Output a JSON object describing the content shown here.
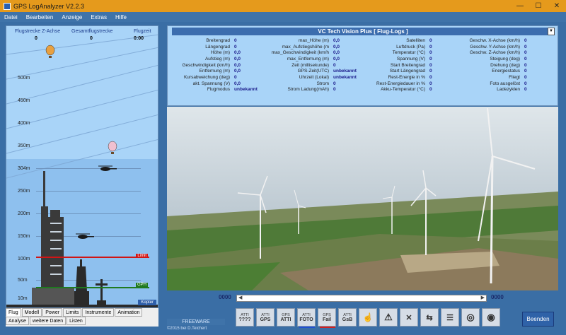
{
  "window": {
    "title": "GPS LogAnalyzer V2.2.3",
    "controls": [
      "—",
      "☐",
      "✕"
    ]
  },
  "menu": [
    "Datei",
    "Bearbeiten",
    "Anzeige",
    "Extras",
    "Hilfe"
  ],
  "left_panel": {
    "headers": [
      {
        "label": "Flugstrecke Z-Achse",
        "value": "0"
      },
      {
        "label": "Gesamtflugstrecke",
        "value": "0"
      },
      {
        "label": "Flugzeit",
        "value": "0:00"
      }
    ],
    "scale_labels": [
      "500m",
      "450m",
      "400m",
      "350m",
      "304m",
      "250m",
      "200m",
      "150m",
      "100m",
      "50m",
      "10m"
    ],
    "tag_red": "Limit",
    "tag_green": "GPH",
    "kopter_label": "Kopter",
    "tabs_row1": [
      "Flug",
      "Modell",
      "Power",
      "Limits",
      "Instrumente",
      "Animation"
    ],
    "tabs_row2": [
      "Analyse",
      "weitere Daten",
      "Listen"
    ]
  },
  "right_panel": {
    "title": "VC Tech Vision Plus [ Flug-Logs ]",
    "col1": [
      {
        "k": "Breitengrad",
        "v": "0"
      },
      {
        "k": "Längengrad",
        "v": "0"
      },
      {
        "k": "Höhe (m)",
        "v": "0,0"
      },
      {
        "k": "Aufstieg (m)",
        "v": "0,0"
      },
      {
        "k": "Geschwindigkeit (km/h)",
        "v": "0,0"
      },
      {
        "k": "Entfernung (m)",
        "v": "0,0"
      },
      {
        "k": "Kursabweichung (deg)",
        "v": "0"
      },
      {
        "k": "akt. Spannung (V)",
        "v": "0,0"
      },
      {
        "k": "Flugmodus",
        "v": "unbekannt"
      }
    ],
    "col2": [
      {
        "k": "max_Höhe (m)",
        "v": "0,0"
      },
      {
        "k": "max_Aufstiegshöhe (m",
        "v": "0,0"
      },
      {
        "k": "max_Geschwindigkeit (km/h",
        "v": "0,0"
      },
      {
        "k": "max_Entfernung (m)",
        "v": "0,0"
      },
      {
        "k": "Zeit (millisekunde)",
        "v": "0"
      },
      {
        "k": "GPS-Zeit(UTC)",
        "v": "unbekannt"
      },
      {
        "k": "Uhrzeit (Lokal)",
        "v": "unbekannt"
      },
      {
        "k": "Strom",
        "v": "0"
      },
      {
        "k": "Strom Ladung(mAh)",
        "v": "0"
      }
    ],
    "col3": [
      {
        "k": "Satelliten",
        "v": "0"
      },
      {
        "k": "Luftdruck (Pa)",
        "v": "0"
      },
      {
        "k": "Temperatur (°C)",
        "v": "0"
      },
      {
        "k": "Spannung (V)",
        "v": "0"
      },
      {
        "k": "Start Breitengrad",
        "v": "0"
      },
      {
        "k": "Start Längengrad",
        "v": "0"
      },
      {
        "k": "Rest-Energie in %",
        "v": "0"
      },
      {
        "k": "Rest-Energiedauer in %",
        "v": "0"
      },
      {
        "k": "Akku-Temperatur (°C)",
        "v": "0"
      }
    ],
    "col4": [
      {
        "k": "Geschw. X-Achse (km/h)",
        "v": "0"
      },
      {
        "k": "Geschw. Y-Achse (km/h)",
        "v": "0"
      },
      {
        "k": "Geschw. Z-Achse (km/h)",
        "v": "0"
      },
      {
        "k": "Steigung (deg)",
        "v": "0"
      },
      {
        "k": "Drehung (deg)",
        "v": "0"
      },
      {
        "k": "Energiestatus",
        "v": "0"
      },
      {
        "k": "Fliegt",
        "v": "0"
      },
      {
        "k": "Foto ausgelöst",
        "v": "0"
      },
      {
        "k": "Ladezyklen",
        "v": "0"
      }
    ]
  },
  "video_slider": {
    "left": "0000",
    "right": "0000"
  },
  "footer": {
    "freeware": "FREEWARE",
    "credit": "©2015  bei D.Teichert"
  },
  "toolbar": [
    {
      "name": "atti-counter-button",
      "top": "ATTI",
      "label": "????",
      "bar": ""
    },
    {
      "name": "atti-gps-button",
      "top": "ATTI",
      "label": "GPS",
      "bar": ""
    },
    {
      "name": "atti-atti-button",
      "top": "GPS",
      "label": "ATTI",
      "bar": ""
    },
    {
      "name": "atti-foto-button",
      "top": "ATTI",
      "label": "FOTO",
      "bar": "#2050d0"
    },
    {
      "name": "fail-button",
      "top": "GPS",
      "label": "Fail",
      "bar": "#d02020"
    },
    {
      "name": "atti-gps-2-button",
      "top": "ATTI",
      "label": "GsB",
      "bar": ""
    },
    {
      "name": "pointer-tool-button",
      "top": "",
      "label": "☝",
      "bar": ""
    },
    {
      "name": "warning-button",
      "top": "",
      "label": "⚠",
      "bar": ""
    },
    {
      "name": "delete-marker-button",
      "top": "",
      "label": "✕",
      "bar": ""
    },
    {
      "name": "map-button",
      "top": "",
      "label": "⇆",
      "bar": ""
    },
    {
      "name": "list-button",
      "top": "",
      "label": "☰",
      "bar": ""
    },
    {
      "name": "target-button",
      "top": "",
      "label": "◎",
      "bar": ""
    },
    {
      "name": "compass-button",
      "top": "",
      "label": "◉",
      "bar": ""
    }
  ],
  "beenden_label": "Beenden"
}
